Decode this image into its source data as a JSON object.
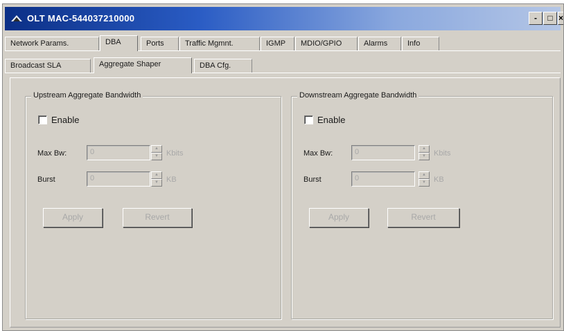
{
  "window": {
    "title": "OLT MAC-544037210000",
    "controls": {
      "minimize": "-",
      "maximize": "□",
      "close": "×"
    }
  },
  "main_tabs": [
    "Network Params.",
    "DBA",
    "Ports",
    "Traffic Mgmnt.",
    "IGMP",
    "MDIO/GPIO",
    "Alarms",
    "Info"
  ],
  "main_tabs_active": "DBA",
  "sub_tabs": [
    "Broadcast SLA",
    "Aggregate Shaper",
    "DBA Cfg."
  ],
  "sub_tabs_active": "Aggregate Shaper",
  "upstream": {
    "title": "Upstream Aggregate Bandwidth",
    "enable_label": "Enable",
    "enabled": false,
    "max_bw_label": "Max Bw:",
    "max_bw_value": "0",
    "max_bw_unit": "Kbits",
    "burst_label": "Burst",
    "burst_value": "0",
    "burst_unit": "KB",
    "apply_label": "Apply",
    "revert_label": "Revert"
  },
  "downstream": {
    "title": "Downstream Aggregate Bandwidth",
    "enable_label": "Enable",
    "enabled": false,
    "max_bw_label": "Max Bw:",
    "max_bw_value": "0",
    "max_bw_unit": "Kbits",
    "burst_label": "Burst",
    "burst_value": "0",
    "burst_unit": "KB",
    "apply_label": "Apply",
    "revert_label": "Revert"
  },
  "colors": {
    "titlebar_start": "#0b2f86",
    "titlebar_end": "#b4c6e6",
    "face": "#d4d0c8"
  },
  "icons": {
    "app": "olt-app-icon"
  }
}
